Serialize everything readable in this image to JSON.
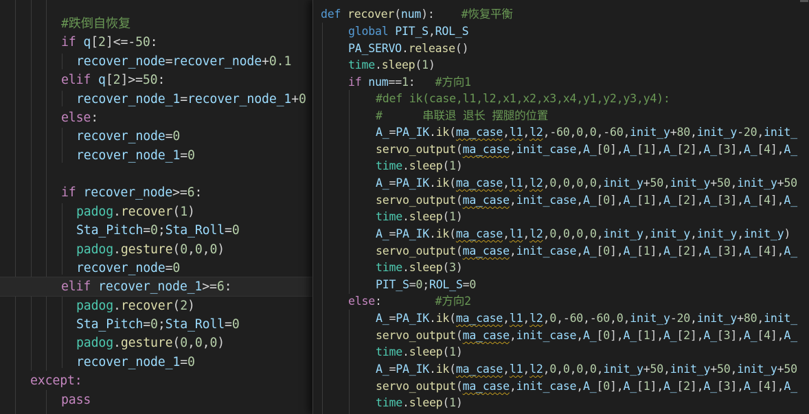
{
  "left_editor": {
    "lines": [
      "",
      "#跌倒自恢复",
      "if q[2]<=-50:",
      "recover_node=recover_node+0.1",
      "elif q[2]>=50:",
      "recover_node_1=recover_node_1+0",
      "else:",
      "recover_node=0",
      "recover_node_1=0",
      "",
      "if recover_node>=6:",
      "padog.recover(1)",
      "Sta_Pitch=0;Sta_Roll=0",
      "padog.gesture(0,0,0)",
      "recover_node=0",
      "elif recover_node_1>=6:",
      "padog.recover(2)",
      "Sta_Pitch=0;Sta_Roll=0",
      "padog.gesture(0,0,0)",
      "recover_node_1=0",
      "except:",
      "pass"
    ]
  },
  "right_editor": {
    "lines": [
      "def recover(num):    #恢复平衡",
      "global PIT_S,ROL_S",
      "PA_SERVO.release()",
      "time.sleep(1)",
      "if num==1:   #方向1",
      "#def ik(case,l1,l2,x1,x2,x3,x4,y1,y2,y3,y4):",
      "#      串联退 退长 摆腿的位置",
      "A_=PA_IK.ik(ma_case,l1,l2,-60,0,0,-60,init_y+80,init_y-20,init_",
      "servo_output(ma_case,init_case,A_[0],A_[1],A_[2],A_[3],A_[4],A_",
      "time.sleep(1)",
      "A_=PA_IK.ik(ma_case,l1,l2,0,0,0,0,init_y+50,init_y+50,init_y+50",
      "servo_output(ma_case,init_case,A_[0],A_[1],A_[2],A_[3],A_[4],A_",
      "time.sleep(1)",
      "A_=PA_IK.ik(ma_case,l1,l2,0,0,0,0,init_y,init_y,init_y,init_y)",
      "servo_output(ma_case,init_case,A_[0],A_[1],A_[2],A_[3],A_[4],A_",
      "time.sleep(3)",
      "PIT_S=0;ROL_S=0",
      "else:        #方向2",
      "A_=PA_IK.ik(ma_case,l1,l2,0,-60,-60,0,init_y-20,init_y+80,init_",
      "servo_output(ma_case,init_case,A_[0],A_[1],A_[2],A_[3],A_[4],A_",
      "time.sleep(1)",
      "A_=PA_IK.ik(ma_case,l1,l2,0,0,0,0,init_y+50,init_y+50,init_y+50",
      "servo_output(ma_case,init_case,A_[0],A_[1],A_[2],A_[3],A_[4],A_",
      "time.sleep(1)"
    ]
  },
  "colors": {
    "keyword": "#c586c0",
    "storage": "#569cd6",
    "function": "#dcdcaa",
    "variable": "#9cdcfe",
    "comment": "#6a9955",
    "number": "#b5cea8",
    "operator": "#d4d4d4",
    "class": "#4ec9b0"
  }
}
